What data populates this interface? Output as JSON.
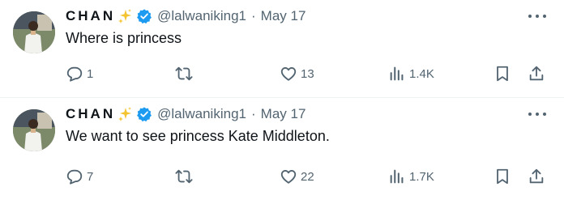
{
  "colors": {
    "text_primary": "#0f1419",
    "text_secondary": "#536471",
    "verified_blue": "#1d9bf0",
    "sparkle_gold": "#f4c430",
    "divider": "#eff3f4"
  },
  "tweets": [
    {
      "author": {
        "display_name": "CHAN",
        "emoji": "sparkles-icon",
        "verified": true,
        "handle": "@lalwaniking1"
      },
      "separator": "·",
      "date": "May 17",
      "text": "Where is princess",
      "stats": {
        "replies": "1",
        "retweets": "",
        "likes": "13",
        "views": "1.4K"
      }
    },
    {
      "author": {
        "display_name": "CHAN",
        "emoji": "sparkles-icon",
        "verified": true,
        "handle": "@lalwaniking1"
      },
      "separator": "·",
      "date": "May 17",
      "text": "We want to see princess Kate Middleton.",
      "stats": {
        "replies": "7",
        "retweets": "",
        "likes": "22",
        "views": "1.7K"
      }
    }
  ]
}
